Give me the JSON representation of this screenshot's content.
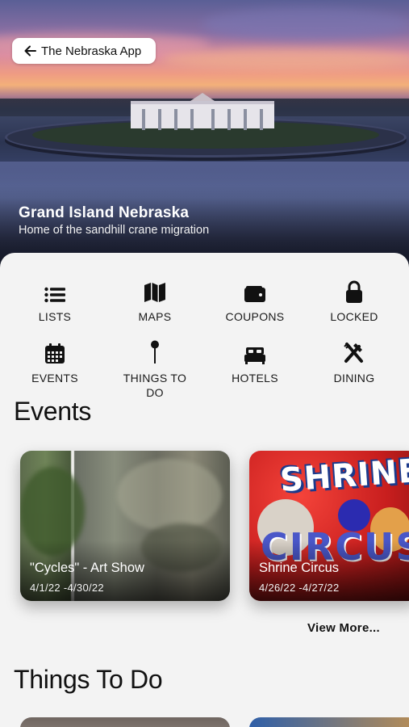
{
  "header": {
    "back_label": "The Nebraska App",
    "title": "Grand Island Nebraska",
    "subtitle": "Home of the sandhill crane migration"
  },
  "menu": [
    {
      "label": "LISTS",
      "icon": "list-icon"
    },
    {
      "label": "MAPS",
      "icon": "map-icon"
    },
    {
      "label": "COUPONS",
      "icon": "wallet-icon"
    },
    {
      "label": "LOCKED",
      "icon": "lock-icon"
    },
    {
      "label": "EVENTS",
      "icon": "calendar-icon"
    },
    {
      "label": "THINGS TO DO",
      "icon": "pin-icon"
    },
    {
      "label": "HOTELS",
      "icon": "bed-icon"
    },
    {
      "label": "DINING",
      "icon": "utensils-icon"
    }
  ],
  "events": {
    "title": "Events",
    "cards": [
      {
        "title": "\"Cycles\" - Art Show",
        "dates": "4/1/22 -4/30/22"
      },
      {
        "title": "Shrine Circus",
        "dates": "4/26/22 -4/27/22",
        "poster_text": "SHRINE CIRCUS"
      }
    ],
    "view_more": "View More..."
  },
  "things_to_do": {
    "title": "Things To Do"
  }
}
